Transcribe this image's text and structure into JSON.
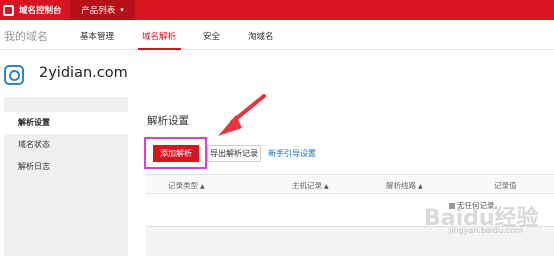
{
  "topbar": {
    "logo_label": "域名控制台",
    "product_menu_label": "产品列表",
    "brand_color": "#d7141f"
  },
  "subnav": {
    "my_domain": "我的域名",
    "tabs": [
      {
        "label": "基本管理"
      },
      {
        "label": "域名解析",
        "active": true
      },
      {
        "label": "安全"
      },
      {
        "label": "淘域名"
      }
    ]
  },
  "domain": {
    "name": "2yidian.com",
    "icon": "globe-icon"
  },
  "sidebar": {
    "items": [
      {
        "label": "解析设置",
        "active": true
      },
      {
        "label": "域名状态"
      },
      {
        "label": "解析日志"
      }
    ]
  },
  "main": {
    "section_title": "解析设置",
    "add_button": "添加解析",
    "export_button": "导出解析记录",
    "guide_link": "新手引导设置",
    "table": {
      "columns": [
        "记录类型",
        "主机记录",
        "解析线路",
        "记录值"
      ],
      "empty_message": "无任何记录。"
    }
  },
  "annotations": {
    "highlight_color": "#e13be6",
    "arrow_color": "#e8343c"
  },
  "watermark": {
    "text": "Baidu经验",
    "sub": "jingyan.baidu.com"
  }
}
